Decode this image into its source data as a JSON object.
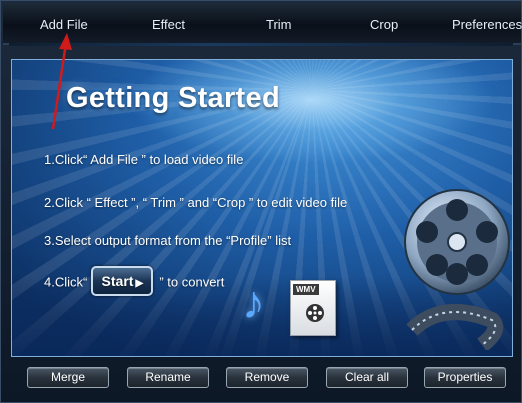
{
  "menu": {
    "add_file": "Add File",
    "effect": "Effect",
    "trim": "Trim",
    "crop": "Crop",
    "preferences": "Preferences"
  },
  "getting_started": {
    "title": "Getting Started",
    "step1": "1.Click“ Add File ” to load video file",
    "step2": "2.Click “ Effect ”, “ Trim ” and “Crop ” to edit video file",
    "step3": "3.Select output format from the “Profile” list",
    "step4_prefix": "4.Click“",
    "start_label": "Start",
    "step4_suffix": "” to convert",
    "file_badge": "WMV"
  },
  "buttons": {
    "merge": "Merge",
    "rename": "Rename",
    "remove": "Remove",
    "clear_all": "Clear all",
    "properties": "Properties"
  },
  "icons": {
    "film_reel": "film-reel-icon",
    "music_note": "music-note-icon",
    "wmv_file": "wmv-file-icon",
    "annotation_arrow": "red-arrow-icon"
  },
  "colors": {
    "annotation": "#d11a1a",
    "stage_blue": "#1f5fa8",
    "menu_text": "#e6eef7"
  }
}
